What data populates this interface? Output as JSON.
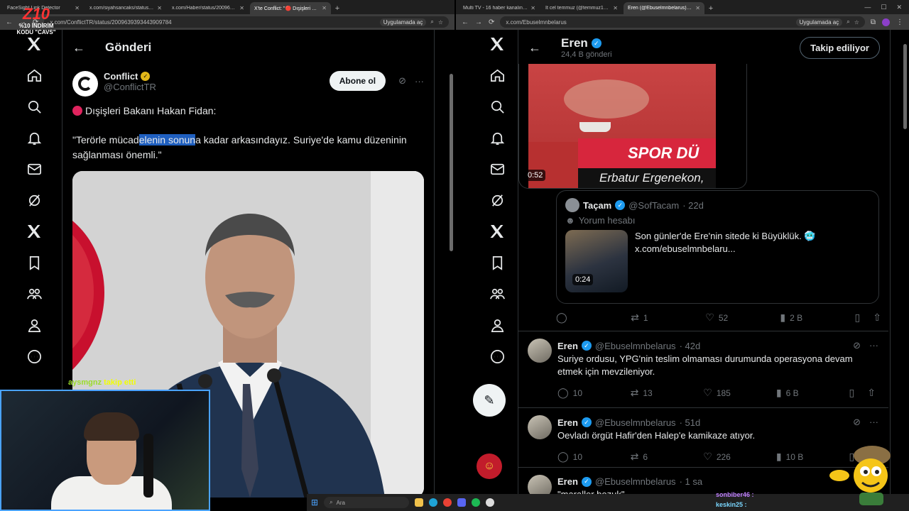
{
  "left_browser": {
    "tabs": [
      {
        "label": "FaceSight Link Detector",
        "active": false
      },
      {
        "label": "x.com/siyahsancaks/status/200",
        "active": false
      },
      {
        "label": "x.com/Haber/status/20096317",
        "active": false
      },
      {
        "label": "X'te Conflict: \"🔴 Dışişleri Baka",
        "active": true
      }
    ],
    "url": "x.com/ConflictTR/status/2009639393443909784",
    "app_chip": "Uygulamada aç"
  },
  "right_browser": {
    "tabs": [
      {
        "label": "Multi TV - 16 haber kanalını ay",
        "active": false
      },
      {
        "label": "It cel temmuz (@temmuz1919",
        "active": false
      },
      {
        "label": "Eren (@Ebuselmnbelarus) / X",
        "active": true
      }
    ],
    "url": "x.com/Ebuselmnbelarus",
    "app_chip": "Uygulamada aç"
  },
  "post_view": {
    "title": "Gönderi",
    "author": {
      "name": "Conflict",
      "handle": "@ConflictTR"
    },
    "subscribe_label": "Abone ol",
    "text_line1": "Dışişleri Bakanı Hakan Fidan:",
    "quote_before": "\"Terörle mücad",
    "quote_selected": "elenin sonun",
    "quote_after": "a kadar arkasındayız. Suriye'de kamu düzeninin sağlanması önemli.\""
  },
  "profile_view": {
    "name": "Eren",
    "post_count": "24,4 B gönderi",
    "follow_label": "Takip ediliyor",
    "video": {
      "duration": "0:52",
      "banner_top": "SPOR DÜ",
      "banner_bottom": "Erbatur Ergenekon,"
    },
    "quoted": {
      "name": "Taçam",
      "handle": "@SofTacam",
      "age": "· 22d",
      "label": "Yorum hesabı",
      "text": "Son günler'de Ere'nin sitede ki Büyüklük. 🥶 x.com/ebuselmnbelaru...",
      "thumb_duration": "0:24"
    },
    "first_actions": {
      "replies": "",
      "reposts": "1",
      "likes": "52",
      "views": "2 B"
    },
    "tweets": [
      {
        "name": "Eren",
        "handle": "@Ebuselmnbelarus",
        "age": "· 42d",
        "text": "Suriye ordusu, YPG'nin teslim olmaması durumunda operasyona devam etmek için mevzileniyor.",
        "replies": "10",
        "reposts": "13",
        "likes": "185",
        "views": "6 B"
      },
      {
        "name": "Eren",
        "handle": "@Ebuselmnbelarus",
        "age": "· 51d",
        "text": "Oevladı örgüt Hafir'den Halep'e kamikaze atıyor.",
        "replies": "10",
        "reposts": "6",
        "likes": "226",
        "views": "10 B"
      },
      {
        "name": "Eren",
        "handle": "@Ebuselmnbelarus",
        "age": "· 1 sa",
        "text": "\"maraller bozuk\""
      }
    ]
  },
  "overlays": {
    "brand_big": "Z10",
    "brand_small": "%10 İNDİRİM KODU \"CAVS\"",
    "follow_user": "aysmgnz",
    "follow_text": "takip etti",
    "chat": [
      {
        "user": "sonbiber46",
        "msg": ":"
      },
      {
        "user": "keskin25",
        "msg": ":"
      }
    ],
    "taskbar_search": "Ara"
  }
}
